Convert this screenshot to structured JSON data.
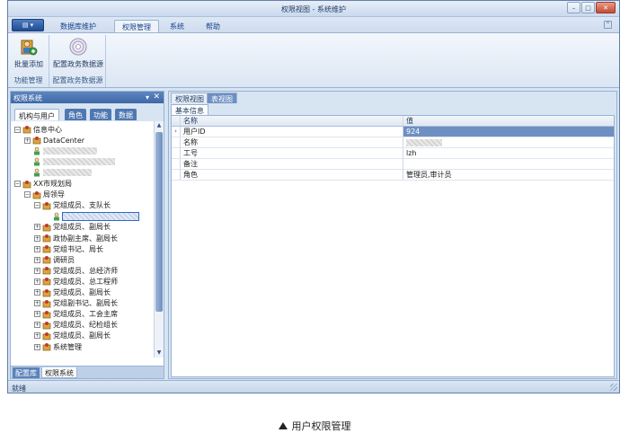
{
  "window": {
    "title": "权限视图 - 系统维护",
    "buttons": {
      "minimize": "–",
      "maximize": "□",
      "close": "✕"
    }
  },
  "ribbon": {
    "app_button": "▤ ▾",
    "tabs": [
      "数据库维护",
      "权限管理",
      "系统",
      "帮助"
    ],
    "active_tab": "权限管理",
    "groups": [
      {
        "label": "功能管理",
        "buttons": [
          {
            "label": "批量添加",
            "icon": "people-add-icon"
          }
        ]
      },
      {
        "label": "配置政务数据源",
        "buttons": [
          {
            "label": "配置政务数据源",
            "icon": "disc-icon"
          }
        ]
      }
    ]
  },
  "left_panel": {
    "title": "权限系统",
    "pin": "▾",
    "close": "✕",
    "tabs": [
      "机构与用户",
      "角色",
      "功能",
      "数据"
    ],
    "active_tab": "机构与用户",
    "tree": [
      {
        "level": 0,
        "type": "org",
        "label": "信息中心",
        "expanded": true
      },
      {
        "level": 1,
        "type": "org",
        "label": "DataCenter"
      },
      {
        "level": 1,
        "type": "user",
        "label": ""
      },
      {
        "level": 1,
        "type": "user",
        "label": ""
      },
      {
        "level": 1,
        "type": "user",
        "label": ""
      },
      {
        "level": 0,
        "type": "org",
        "label": "XX市规划局",
        "expanded": true
      },
      {
        "level": 1,
        "type": "org",
        "label": "局领导",
        "expanded": true
      },
      {
        "level": 2,
        "type": "org",
        "label": "党组成员、支队长",
        "expanded": true
      },
      {
        "level": 3,
        "type": "user",
        "label": "",
        "selected": true
      },
      {
        "level": 2,
        "type": "org",
        "label": "党组成员、副局长"
      },
      {
        "level": 2,
        "type": "org",
        "label": "政协副主席、副局长"
      },
      {
        "level": 2,
        "type": "org",
        "label": "党组书记、局长"
      },
      {
        "level": 2,
        "type": "org",
        "label": "调研员"
      },
      {
        "level": 2,
        "type": "org",
        "label": "党组成员、总经济师"
      },
      {
        "level": 2,
        "type": "org",
        "label": "党组成员、总工程师"
      },
      {
        "level": 2,
        "type": "org",
        "label": "党组成员、副局长"
      },
      {
        "level": 2,
        "type": "org",
        "label": "党组副书记、副局长"
      },
      {
        "level": 2,
        "type": "org",
        "label": "党组成员、工会主席"
      },
      {
        "level": 2,
        "type": "org",
        "label": "党组成员、纪检组长"
      },
      {
        "level": 2,
        "type": "org",
        "label": "党组成员、副局长"
      },
      {
        "level": 2,
        "type": "org",
        "label": "系统管理"
      }
    ],
    "bottom_tabs": [
      "配置库",
      "权限系统"
    ],
    "active_bottom_tab": "权限系统"
  },
  "right_panel": {
    "view_tabs": [
      "权限视图",
      "表视图"
    ],
    "active_view_tab": "表视图",
    "section_tab": "基本信息",
    "grid": {
      "columns": [
        "名称",
        "值"
      ],
      "rows": [
        {
          "name": "用户ID",
          "value": "924",
          "selected": true
        },
        {
          "name": "名称",
          "value": ""
        },
        {
          "name": "工号",
          "value": "lzh"
        },
        {
          "name": "备注",
          "value": ""
        },
        {
          "name": "角色",
          "value": "管理员,审计员"
        }
      ]
    }
  },
  "statusbar": {
    "text": "就绪"
  },
  "caption": {
    "text": "用户权限管理"
  }
}
